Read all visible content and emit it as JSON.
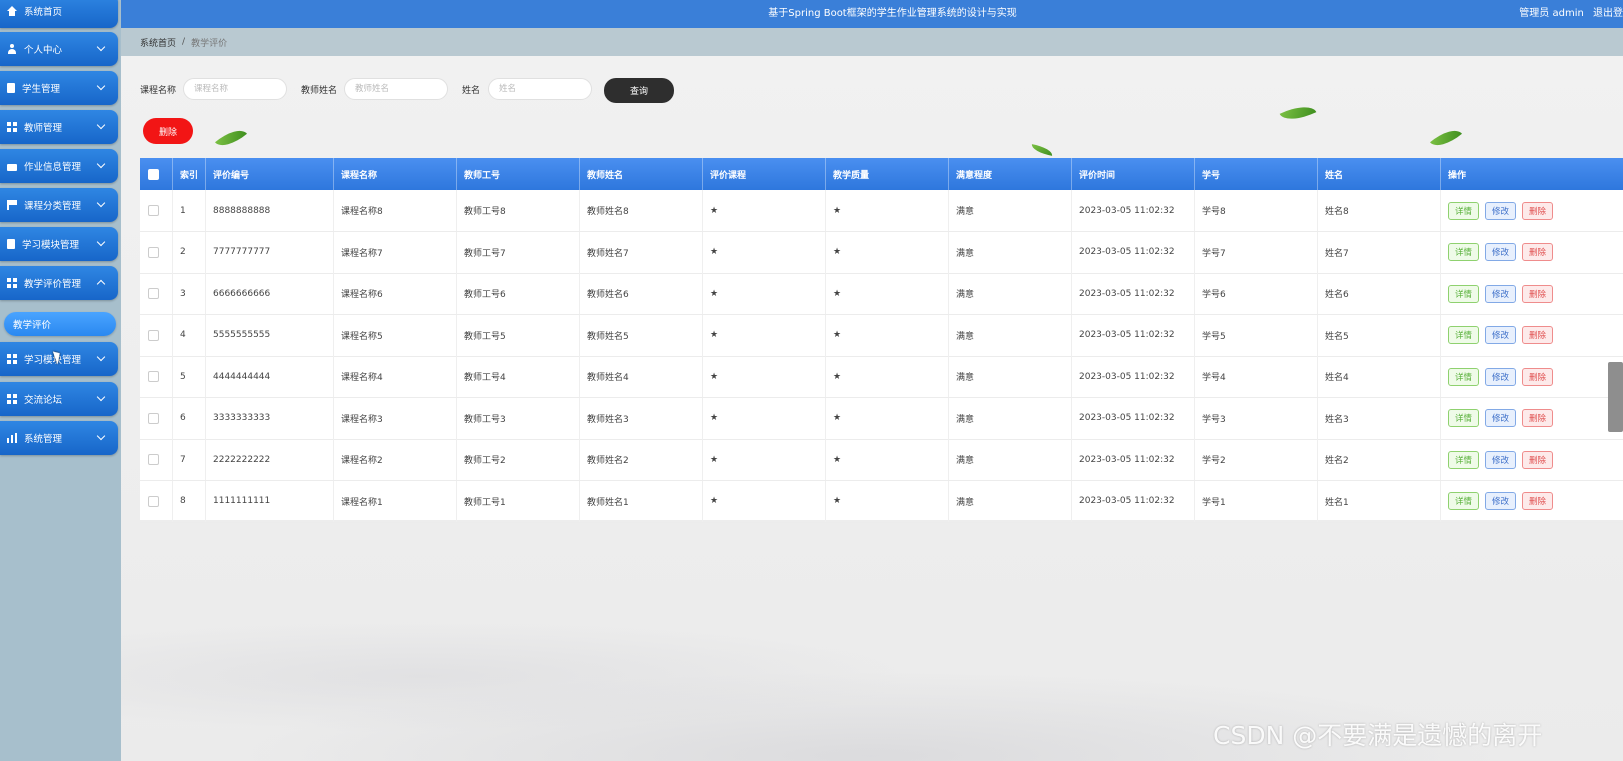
{
  "header": {
    "title": "基于Spring Boot框架的学生作业管理系统的设计与实现",
    "user_text": "管理员 admin",
    "logout": "退出登"
  },
  "breadcrumb": {
    "home": "系统首页",
    "separator": "/",
    "current": "教学评价"
  },
  "sidebar": {
    "items": [
      {
        "label": "系统首页",
        "icon": "home-icon"
      },
      {
        "label": "个人中心",
        "icon": "user-icon"
      },
      {
        "label": "学生管理",
        "icon": "doc-icon"
      },
      {
        "label": "教师管理",
        "icon": "grid-icon"
      },
      {
        "label": "作业信息管理",
        "icon": "briefcase-icon"
      },
      {
        "label": "课程分类管理",
        "icon": "flag-icon"
      },
      {
        "label": "学习模块管理",
        "icon": "doc-icon"
      },
      {
        "label": "教学评价管理",
        "icon": "grid-icon"
      },
      {
        "label": "学习模块管理",
        "icon": "grid-icon"
      },
      {
        "label": "交流论坛",
        "icon": "grid-icon"
      },
      {
        "label": "系统管理",
        "icon": "chart-icon"
      }
    ],
    "sub_item": "教学评价"
  },
  "search": {
    "course_label": "课程名称",
    "course_placeholder": "课程名称",
    "teacher_label": "教师姓名",
    "teacher_placeholder": "教师姓名",
    "name_label": "姓名",
    "name_placeholder": "姓名",
    "query_button": "查询"
  },
  "actions": {
    "delete_button": "删除"
  },
  "table": {
    "columns": [
      "索引",
      "评价编号",
      "课程名称",
      "教师工号",
      "教师姓名",
      "评价课程",
      "教学质量",
      "满意程度",
      "评价时间",
      "学号",
      "姓名",
      "操作"
    ],
    "rows": [
      {
        "idx": "1",
        "code": "8888888888",
        "course": "课程名称8",
        "tno": "教师工号8",
        "tname": "教师姓名8",
        "eval": "★",
        "quality": "★",
        "satis": "满意",
        "time": "2023-03-05 11:02:32",
        "sno": "学号8",
        "sname": "姓名8"
      },
      {
        "idx": "2",
        "code": "7777777777",
        "course": "课程名称7",
        "tno": "教师工号7",
        "tname": "教师姓名7",
        "eval": "★",
        "quality": "★",
        "satis": "满意",
        "time": "2023-03-05 11:02:32",
        "sno": "学号7",
        "sname": "姓名7"
      },
      {
        "idx": "3",
        "code": "6666666666",
        "course": "课程名称6",
        "tno": "教师工号6",
        "tname": "教师姓名6",
        "eval": "★",
        "quality": "★",
        "satis": "满意",
        "time": "2023-03-05 11:02:32",
        "sno": "学号6",
        "sname": "姓名6"
      },
      {
        "idx": "4",
        "code": "5555555555",
        "course": "课程名称5",
        "tno": "教师工号5",
        "tname": "教师姓名5",
        "eval": "★",
        "quality": "★",
        "satis": "满意",
        "time": "2023-03-05 11:02:32",
        "sno": "学号5",
        "sname": "姓名5"
      },
      {
        "idx": "5",
        "code": "4444444444",
        "course": "课程名称4",
        "tno": "教师工号4",
        "tname": "教师姓名4",
        "eval": "★",
        "quality": "★",
        "satis": "满意",
        "time": "2023-03-05 11:02:32",
        "sno": "学号4",
        "sname": "姓名4"
      },
      {
        "idx": "6",
        "code": "3333333333",
        "course": "课程名称3",
        "tno": "教师工号3",
        "tname": "教师姓名3",
        "eval": "★",
        "quality": "★",
        "satis": "满意",
        "time": "2023-03-05 11:02:32",
        "sno": "学号3",
        "sname": "姓名3"
      },
      {
        "idx": "7",
        "code": "2222222222",
        "course": "课程名称2",
        "tno": "教师工号2",
        "tname": "教师姓名2",
        "eval": "★",
        "quality": "★",
        "satis": "满意",
        "time": "2023-03-05 11:02:32",
        "sno": "学号2",
        "sname": "姓名2"
      },
      {
        "idx": "8",
        "code": "1111111111",
        "course": "课程名称1",
        "tno": "教师工号1",
        "tname": "教师姓名1",
        "eval": "★",
        "quality": "★",
        "satis": "满意",
        "time": "2023-03-05 11:02:32",
        "sno": "学号1",
        "sname": "姓名1"
      }
    ],
    "row_actions": {
      "detail": "详情",
      "edit": "修改",
      "delete": "删除"
    }
  },
  "watermark": "CSDN @不要满是遗憾的离开",
  "colors": {
    "header": "#3a7fd8",
    "nav": "#1f74d6",
    "delete": "#f21515",
    "query": "#2e2e2e"
  }
}
